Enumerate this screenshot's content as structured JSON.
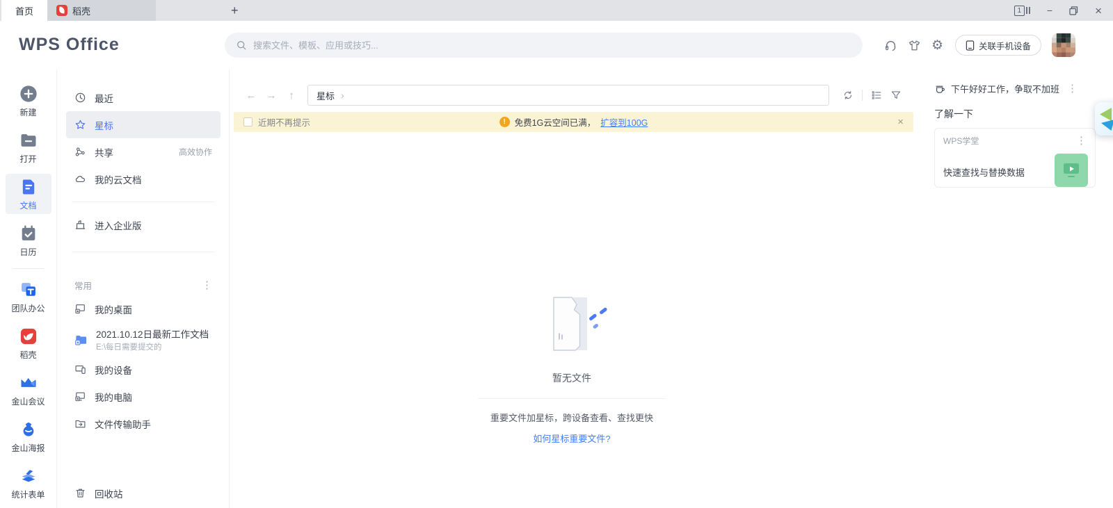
{
  "tabbar": {
    "tabs": [
      {
        "label": "首页",
        "active": true
      },
      {
        "label": "稻壳",
        "active": false
      }
    ],
    "new_tab_glyph": "+",
    "tab_count": "1"
  },
  "header": {
    "logo": "WPS Office",
    "search_placeholder": "搜索文件、模板、应用或技巧...",
    "link_device_label": "关联手机设备"
  },
  "rail": {
    "items": [
      {
        "label": "新建"
      },
      {
        "label": "打开"
      },
      {
        "label": "文档",
        "selected": true
      },
      {
        "label": "日历"
      },
      {
        "label": "团队办公"
      },
      {
        "label": "稻壳"
      },
      {
        "label": "金山会议"
      },
      {
        "label": "金山海报"
      },
      {
        "label": "统计表单"
      }
    ]
  },
  "nav": {
    "recent": "最近",
    "starred": "星标",
    "shared": "共享",
    "shared_badge": "高效协作",
    "cloud_docs": "我的云文档",
    "enterprise": "进入企业版",
    "section_common": "常用",
    "my_desktop": "我的桌面",
    "work_folder_title": "2021.10.12日最新工作文档",
    "work_folder_path": "E:\\每日需要提交的",
    "my_devices": "我的设备",
    "my_computer": "我的电脑",
    "file_transfer": "文件传输助手",
    "recycle_bin": "回收站"
  },
  "main": {
    "breadcrumb": "星标",
    "banner": {
      "dismiss_label": "近期不再提示",
      "message": "免费1G云空间已满，",
      "link": "扩容到100G"
    },
    "empty": {
      "title": "暂无文件",
      "desc": "重要文件加星标，跨设备查看、查找更快",
      "link": "如何星标重要文件?"
    }
  },
  "aside": {
    "greeting": "下午好好工作，争取不加班",
    "section": "了解一下",
    "card_title": "WPS学堂",
    "card_item": "快速查找与替换数据"
  },
  "icons": {
    "kebab": "⋮",
    "close_small": "×",
    "close_window": "×",
    "minimize": "−",
    "back": "←",
    "forward": "→",
    "up": "↑",
    "chevron": "›"
  },
  "colors": {
    "primary_blue": "#4b74f0",
    "link_blue": "#417ff9",
    "banner_bg": "#fbf4d4",
    "warning_orange": "#f2a51f",
    "thumb_green": "#8fd8ab",
    "docer_red": "#e5413c"
  }
}
